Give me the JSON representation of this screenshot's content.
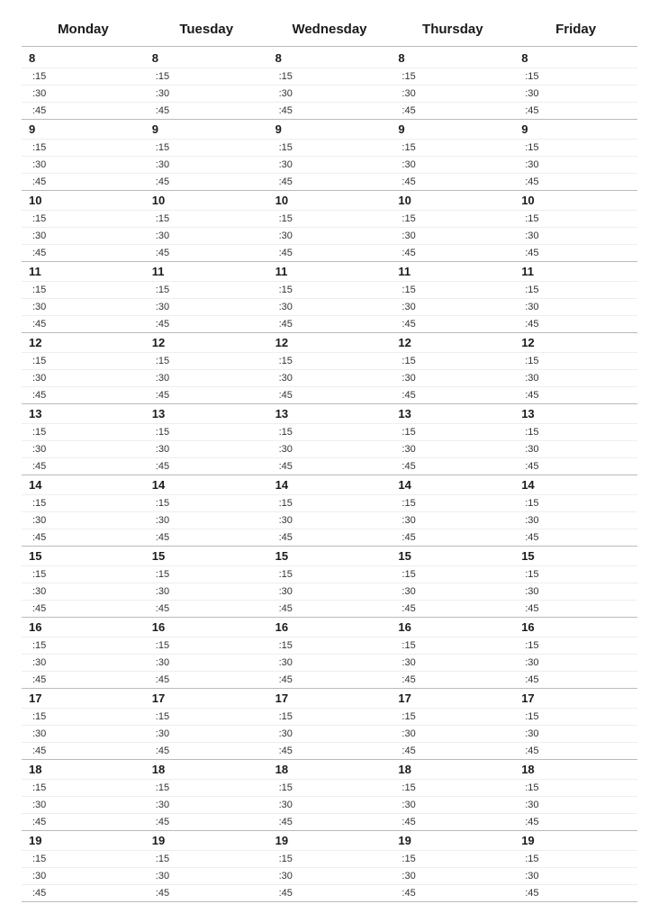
{
  "days": [
    "Monday",
    "Tuesday",
    "Wednesday",
    "Thursday",
    "Friday"
  ],
  "hours": [
    "8",
    "9",
    "10",
    "11",
    "12",
    "13",
    "14",
    "15",
    "16",
    "17",
    "18",
    "19"
  ],
  "minutes": [
    ":15",
    ":30",
    ":45"
  ]
}
